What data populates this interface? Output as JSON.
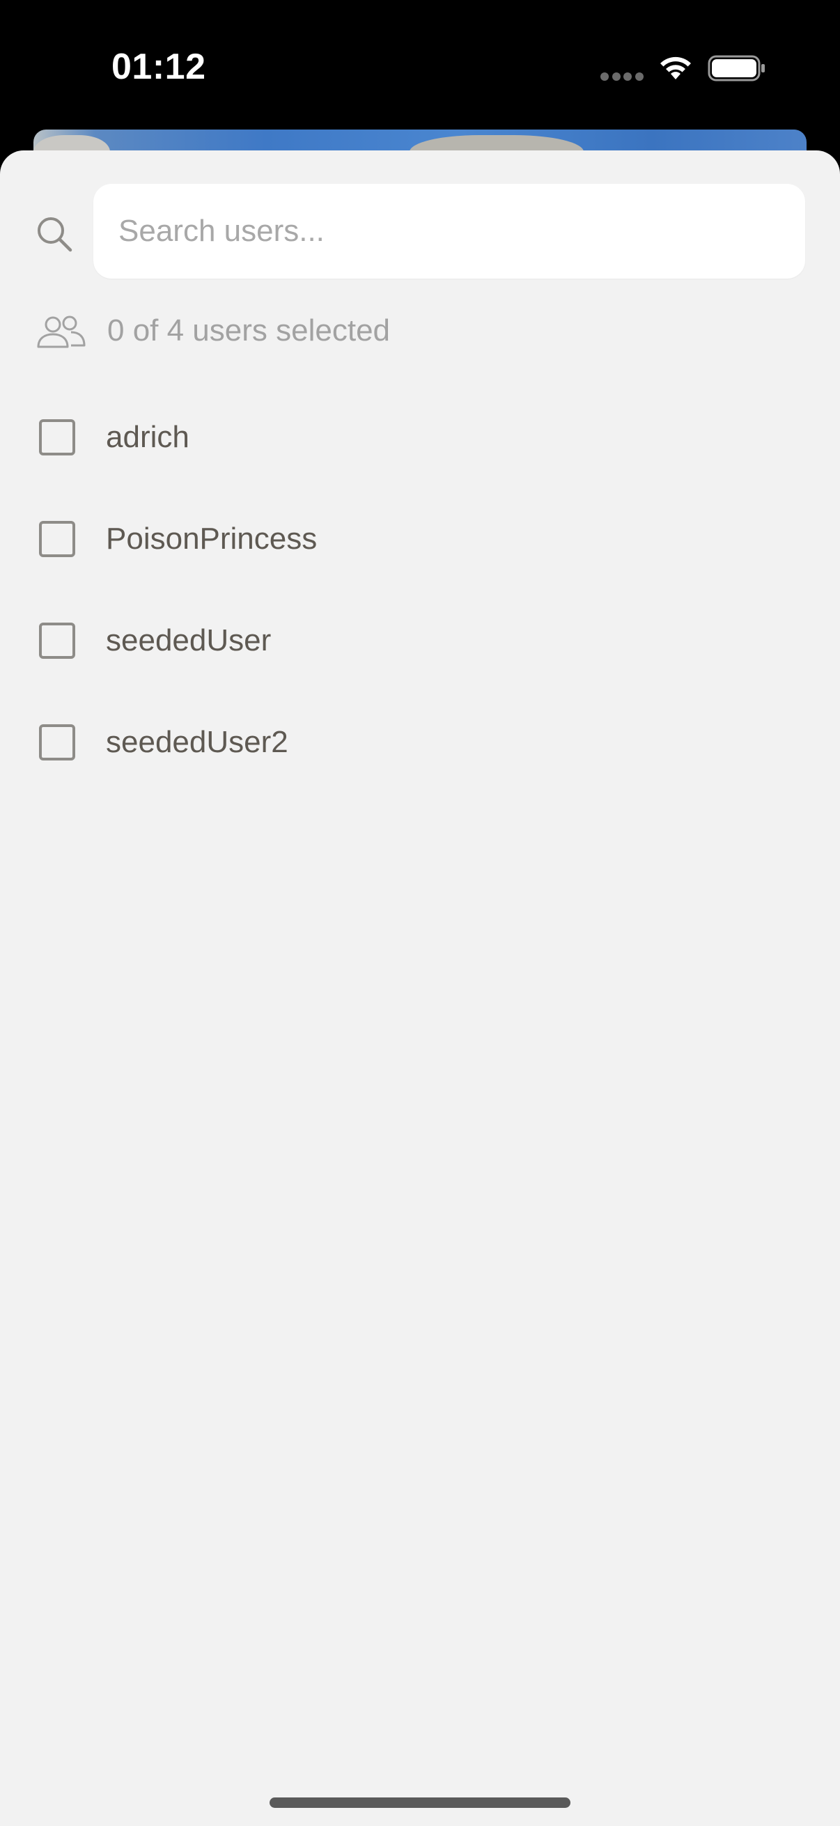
{
  "status_bar": {
    "time": "01:12",
    "icons": [
      "signal-dots-icon",
      "wifi-icon",
      "battery-icon"
    ]
  },
  "search": {
    "placeholder": "Search users...",
    "value": "",
    "icon": "search-icon"
  },
  "selection": {
    "icon": "users-icon",
    "summary": "0 of 4 users selected",
    "selected_count": 0,
    "total_count": 4
  },
  "users": [
    {
      "name": "adrich",
      "checked": false
    },
    {
      "name": "PoisonPrincess",
      "checked": false
    },
    {
      "name": "seededUser",
      "checked": false
    },
    {
      "name": "seededUser2",
      "checked": false
    }
  ],
  "colors": {
    "sheet_background": "#f2f2f2",
    "search_background": "#ffffff",
    "placeholder_text": "#a8a8a8",
    "secondary_text": "#a2a2a2",
    "user_text": "#5e5952",
    "checkbox_border": "#8e8c88",
    "status_bar_background": "#000000"
  }
}
